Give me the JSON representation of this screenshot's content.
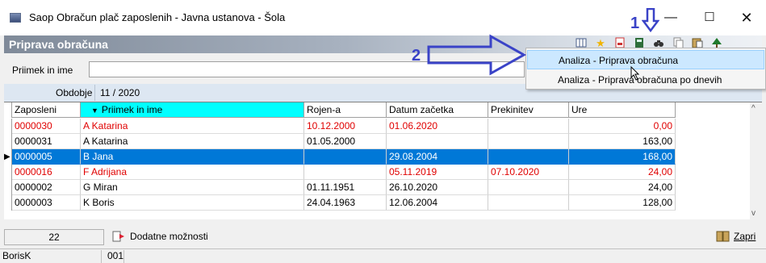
{
  "window": {
    "title": "Saop Obračun plač zaposlenih - Javna ustanova - Šola",
    "minimize": "—",
    "maximize": "☐",
    "close": "✕"
  },
  "panel": {
    "title": "Priprava obračuna"
  },
  "toolbar": {
    "icons": [
      "columns-icon",
      "star-icon",
      "export-icon",
      "calculator-icon",
      "binoculars-icon",
      "copy-icon",
      "paste-icon",
      "tree-icon"
    ]
  },
  "filter": {
    "label": "Priimek in ime",
    "value": ""
  },
  "period": {
    "label": "Obdobje",
    "value": "11 / 2020"
  },
  "grid": {
    "columns": [
      "Zaposleni",
      "Priimek in ime",
      "Rojen-a",
      "Datum začetka",
      "Prekinitev",
      "Ure"
    ],
    "sorted_indicator": "▼",
    "rows": [
      {
        "emp": "0000030",
        "name": "A Katarina",
        "born": "10.12.2000",
        "start": "01.06.2020",
        "interrupt": "",
        "hours": "0,00",
        "style": "red"
      },
      {
        "emp": "0000031",
        "name": "A Katarina",
        "born": "01.05.2000",
        "start": "",
        "interrupt": "",
        "hours": "163,00",
        "style": "normal"
      },
      {
        "emp": "0000005",
        "name": "B Jana",
        "born": "",
        "start": "29.08.2004",
        "interrupt": "",
        "hours": "168,00",
        "style": "selected"
      },
      {
        "emp": "0000016",
        "name": "F Adrijana",
        "born": "",
        "start": "05.11.2019",
        "interrupt": "07.10.2020",
        "hours": "24,00",
        "style": "red"
      },
      {
        "emp": "0000002",
        "name": "G Miran",
        "born": "01.11.1951",
        "start": "26.10.2020",
        "interrupt": "",
        "hours": "24,00",
        "style": "normal"
      },
      {
        "emp": "0000003",
        "name": "K Boris",
        "born": "24.04.1963",
        "start": "12.06.2004",
        "interrupt": "",
        "hours": "128,00",
        "style": "normal"
      }
    ]
  },
  "footer": {
    "count": "22",
    "more_options": "Dodatne možnosti",
    "close": "Zapri"
  },
  "status": {
    "user": "BorisK",
    "code": "001"
  },
  "popup_menu": {
    "items": [
      "Analiza - Priprava obračuna",
      "Analiza - Priprava obračuna po dnevih"
    ]
  },
  "annotations": {
    "one": "1",
    "two": "2"
  },
  "colors": {
    "selection": "#0078d7",
    "warning_text": "#e00000",
    "sorted_header": "#00ffff",
    "annotation": "#3a43c7"
  }
}
